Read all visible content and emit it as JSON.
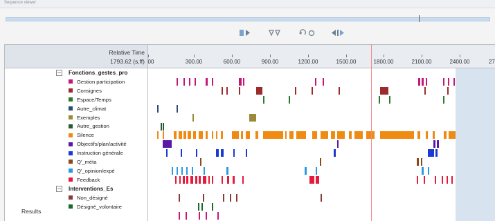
{
  "window": {
    "title": "Sequence viewer"
  },
  "toolbar": {
    "buttons": [
      {
        "name": "play-selection-button",
        "icon": "play-selection-icon"
      },
      {
        "name": "step-frames-button",
        "icon": "step-frames-icon"
      },
      {
        "name": "undo-redo-button",
        "icon": "undo-redo-icon"
      },
      {
        "name": "rewind-forward-button",
        "icon": "rewind-forward-icon"
      }
    ]
  },
  "ruler": {
    "label": "Relative Time",
    "value": "1793.62 (s,ff)",
    "ticks": [
      "00",
      "300.00",
      "600.00",
      "900.00",
      "1200.00",
      "1500.00",
      "1800.00",
      "2100.00",
      "2400.00",
      "2700."
    ],
    "tick_values": [
      0,
      300,
      600,
      900,
      1200,
      1500,
      1800,
      2100,
      2400,
      2700
    ],
    "cursor_time": 1793.62
  },
  "sidebar": {
    "results_label": "Results"
  },
  "groups": [
    {
      "label": "Fonctions_gestes_pro",
      "expanded_symbol": "−",
      "items": [
        {
          "label": "Gestion participation",
          "color": "#c2187a"
        },
        {
          "label": "Consignes",
          "color": "#9c2b2b"
        },
        {
          "label": "Espace/Temps",
          "color": "#2d7a2d"
        },
        {
          "label": "Autre_climat",
          "color": "#2d4a78"
        },
        {
          "label": "Exemples",
          "color": "#9a8a3a"
        },
        {
          "label": "Autre_gestion",
          "color": "#2a5a3a"
        },
        {
          "label": "Silence",
          "color": "#ef8a12"
        },
        {
          "label": "Objectifs/plan/activité",
          "color": "#5a1aa6"
        },
        {
          "label": "Instruction générale",
          "color": "#1a3ad6"
        },
        {
          "label": "Q'_méta",
          "color": "#8a4a1a"
        },
        {
          "label": "Q'_opinion/expé",
          "color": "#2a9ae6"
        },
        {
          "label": "Feedback",
          "color": "#e61a3a"
        }
      ]
    },
    {
      "label": "Interventions_Es",
      "expanded_symbol": "−",
      "items": [
        {
          "label": "Non_désigné",
          "color": "#8a3a3a"
        },
        {
          "label": "Désigné_volontaire",
          "color": "#1a6a2a"
        }
      ]
    }
  ],
  "tracks": [
    [
      [
        40,
        2,
        "#c2187a"
      ],
      [
        50,
        2,
        "#c2187a"
      ],
      [
        58,
        2,
        "#c2187a"
      ],
      [
        66,
        2,
        "#c2187a"
      ],
      [
        82,
        3,
        "#c2187a"
      ],
      [
        91,
        2,
        "#c2187a"
      ],
      [
        130,
        4,
        "#c2187a"
      ],
      [
        136,
        2,
        "#c2187a"
      ],
      [
        240,
        2,
        "#c2187a"
      ],
      [
        251,
        2,
        "#c2187a"
      ],
      [
        389,
        3,
        "#c2187a"
      ],
      [
        394,
        3,
        "#c2187a"
      ],
      [
        400,
        2,
        "#c2187a"
      ],
      [
        425,
        2,
        "#c2187a"
      ],
      [
        432,
        2,
        "#c2187a"
      ],
      [
        440,
        2,
        "#c2187a"
      ]
    ],
    [
      [
        105,
        2,
        "#9c2b2b"
      ],
      [
        112,
        2,
        "#9c2b2b"
      ],
      [
        130,
        2,
        "#9c2b2b"
      ],
      [
        155,
        9,
        "#9c2b2b"
      ],
      [
        211,
        2,
        "#9c2b2b"
      ],
      [
        235,
        2,
        "#9c2b2b"
      ],
      [
        274,
        2,
        "#9c2b2b"
      ],
      [
        334,
        12,
        "#9c2b2b"
      ],
      [
        398,
        2,
        "#9c2b2b"
      ],
      [
        431,
        2,
        "#9c2b2b"
      ]
    ],
    [
      [
        165,
        2,
        "#2d7a2d"
      ],
      [
        202,
        2,
        "#2d7a2d"
      ],
      [
        332,
        2,
        "#2d7a2d"
      ],
      [
        347,
        2,
        "#2d7a2d"
      ],
      [
        425,
        2,
        "#2d7a2d"
      ]
    ],
    [
      [
        12,
        2,
        "#2d4a78"
      ],
      [
        40,
        2,
        "#2d4a78"
      ]
    ],
    [
      [
        145,
        10,
        "#9a8a3a"
      ],
      [
        63,
        2,
        "#9a8a3a"
      ]
    ],
    [
      [
        17,
        2,
        "#2a5a3a"
      ],
      [
        20,
        2,
        "#2a5a3a"
      ]
    ],
    [
      [
        12,
        2,
        "#ef8a12"
      ],
      [
        20,
        2,
        "#ef8a12"
      ],
      [
        36,
        4,
        "#ef8a12"
      ],
      [
        43,
        5,
        "#ef8a12"
      ],
      [
        50,
        4,
        "#ef8a12"
      ],
      [
        56,
        5,
        "#ef8a12"
      ],
      [
        64,
        4,
        "#ef8a12"
      ],
      [
        72,
        6,
        "#ef8a12"
      ],
      [
        82,
        3,
        "#ef8a12"
      ],
      [
        91,
        2,
        "#ef8a12"
      ],
      [
        97,
        2,
        "#ef8a12"
      ],
      [
        104,
        3,
        "#ef8a12"
      ],
      [
        120,
        10,
        "#ef8a12"
      ],
      [
        133,
        3,
        "#ef8a12"
      ],
      [
        140,
        6,
        "#ef8a12"
      ],
      [
        154,
        4,
        "#ef8a12"
      ],
      [
        165,
        29,
        "#ef8a12"
      ],
      [
        197,
        2,
        "#ef8a12"
      ],
      [
        203,
        6,
        "#ef8a12"
      ],
      [
        213,
        14,
        "#ef8a12"
      ],
      [
        236,
        7,
        "#ef8a12"
      ],
      [
        248,
        11,
        "#ef8a12"
      ],
      [
        263,
        6,
        "#ef8a12"
      ],
      [
        272,
        11,
        "#ef8a12"
      ],
      [
        289,
        4,
        "#ef8a12"
      ],
      [
        297,
        12,
        "#ef8a12"
      ],
      [
        314,
        12,
        "#ef8a12"
      ],
      [
        334,
        49,
        "#ef8a12"
      ],
      [
        388,
        4,
        "#ef8a12"
      ],
      [
        400,
        3,
        "#ef8a12"
      ],
      [
        410,
        3,
        "#ef8a12"
      ],
      [
        426,
        4,
        "#ef8a12"
      ],
      [
        433,
        10,
        "#ef8a12"
      ]
    ],
    [
      [
        20,
        13,
        "#5a1aa6"
      ],
      [
        272,
        2,
        "#5a1aa6"
      ],
      [
        411,
        3,
        "#5a1aa6"
      ],
      [
        416,
        3,
        "#5a1aa6"
      ]
    ],
    [
      [
        25,
        2,
        "#1a3ad6"
      ],
      [
        46,
        2,
        "#1a3ad6"
      ],
      [
        68,
        2,
        "#1a3ad6"
      ],
      [
        97,
        4,
        "#1a3ad6"
      ],
      [
        104,
        4,
        "#1a3ad6"
      ],
      [
        122,
        2,
        "#1a3ad6"
      ],
      [
        140,
        2,
        "#1a3ad6"
      ],
      [
        267,
        3,
        "#1a3ad6"
      ],
      [
        403,
        9,
        "#1a3ad6"
      ],
      [
        414,
        3,
        "#1a3ad6"
      ],
      [
        447,
        2,
        "#1a3ad6"
      ]
    ],
    [
      [
        74,
        2,
        "#8a4a1a"
      ],
      [
        247,
        2,
        "#8a4a1a"
      ],
      [
        387,
        3,
        "#8a4a1a"
      ],
      [
        393,
        2,
        "#8a4a1a"
      ]
    ],
    [
      [
        33,
        2,
        "#2a9ae6"
      ],
      [
        40,
        2,
        "#2a9ae6"
      ],
      [
        47,
        2,
        "#2a9ae6"
      ],
      [
        54,
        2,
        "#2a9ae6"
      ],
      [
        62,
        2,
        "#2a9ae6"
      ],
      [
        79,
        2,
        "#2a9ae6"
      ],
      [
        112,
        3,
        "#2a9ae6"
      ],
      [
        225,
        3,
        "#2a9ae6"
      ],
      [
        241,
        2,
        "#2a9ae6"
      ],
      [
        394,
        3,
        "#2a9ae6"
      ],
      [
        403,
        2,
        "#2a9ae6"
      ]
    ],
    [
      [
        38,
        2,
        "#e61a3a"
      ],
      [
        44,
        2,
        "#e61a3a"
      ],
      [
        49,
        3,
        "#e61a3a"
      ],
      [
        54,
        3,
        "#e61a3a"
      ],
      [
        60,
        4,
        "#e61a3a"
      ],
      [
        67,
        3,
        "#e61a3a"
      ],
      [
        72,
        3,
        "#e61a3a"
      ],
      [
        78,
        5,
        "#e61a3a"
      ],
      [
        86,
        2,
        "#e61a3a"
      ],
      [
        91,
        2,
        "#e61a3a"
      ],
      [
        105,
        2,
        "#e61a3a"
      ],
      [
        113,
        3,
        "#e61a3a"
      ],
      [
        121,
        3,
        "#e61a3a"
      ],
      [
        135,
        2,
        "#e61a3a"
      ],
      [
        232,
        7,
        "#e61a3a"
      ],
      [
        241,
        5,
        "#e61a3a"
      ],
      [
        387,
        2,
        "#e61a3a"
      ],
      [
        397,
        2,
        "#e61a3a"
      ],
      [
        413,
        2,
        "#e61a3a"
      ],
      [
        423,
        2,
        "#e61a3a"
      ],
      [
        430,
        2,
        "#e61a3a"
      ],
      [
        437,
        2,
        "#e61a3a"
      ]
    ],
    [],
    [
      [
        43,
        2,
        "#8a3a3a"
      ],
      [
        78,
        2,
        "#8a3a3a"
      ],
      [
        107,
        2,
        "#8a3a3a"
      ],
      [
        117,
        2,
        "#8a3a3a"
      ],
      [
        126,
        2,
        "#8a3a3a"
      ],
      [
        248,
        2,
        "#8a3a3a"
      ]
    ],
    [
      [
        71,
        2,
        "#1a6a2a"
      ],
      [
        76,
        2,
        "#1a6a2a"
      ],
      [
        91,
        2,
        "#1a6a2a"
      ]
    ],
    [
      [
        43,
        2,
        "#c2187a"
      ],
      [
        53,
        2,
        "#c2187a"
      ],
      [
        72,
        2,
        "#c2187a"
      ],
      [
        82,
        2,
        "#c2187a"
      ],
      [
        99,
        2,
        "#c2187a"
      ]
    ]
  ]
}
